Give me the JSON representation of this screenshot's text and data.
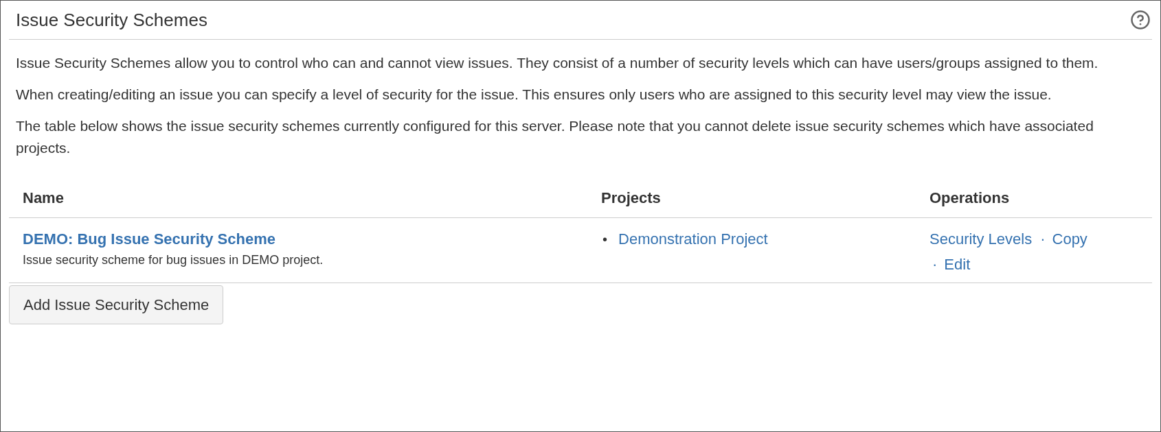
{
  "page": {
    "title": "Issue Security Schemes"
  },
  "paragraphs": [
    "Issue Security Schemes allow you to control who can and cannot view issues. They consist of a number of security levels which can have users/groups assigned to them.",
    "When creating/editing an issue you can specify a level of security for the issue. This ensures only users who are assigned to this security level may view the issue.",
    "The table below shows the issue security schemes currently configured for this server. Please note that you cannot delete issue security schemes which have associated projects."
  ],
  "table": {
    "columns": [
      "Name",
      "Projects",
      "Operations"
    ],
    "rows": [
      {
        "name": "DEMO: Bug Issue Security Scheme",
        "description": "Issue security scheme for bug issues in DEMO project.",
        "projects": [
          {
            "bullet": "•",
            "label": "Demonstration Project"
          }
        ],
        "operations": [
          {
            "label": "Security Levels"
          },
          {
            "separator": "·",
            "label": "Copy"
          },
          {
            "separator": "·",
            "label": "Edit"
          }
        ]
      }
    ]
  },
  "add_button": "Add Issue Security Scheme"
}
